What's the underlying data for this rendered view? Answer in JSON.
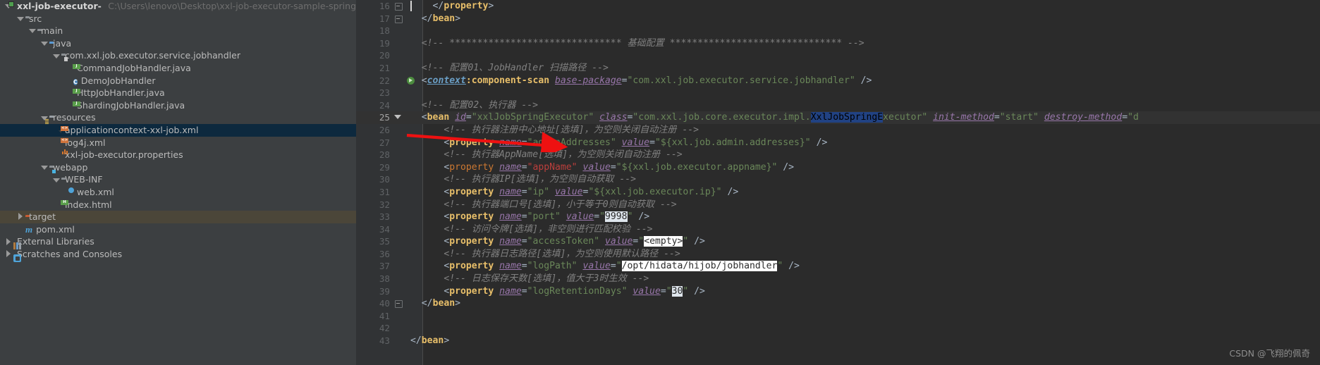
{
  "sidebar": {
    "items": [
      {
        "label": "xxl-job-executor-sample-spring",
        "path": "C:\\Users\\lenovo\\Desktop\\xxl-job-executor-sample-spring",
        "icon": "module-icon",
        "indent": 0,
        "twisty": "open",
        "bold": true,
        "state": "normal"
      },
      {
        "label": "src",
        "path": "",
        "icon": "folder-icon",
        "indent": 1,
        "twisty": "open",
        "bold": false,
        "state": "normal"
      },
      {
        "label": "main",
        "path": "",
        "icon": "folder-icon",
        "indent": 2,
        "twisty": "open",
        "bold": false,
        "state": "normal"
      },
      {
        "label": "java",
        "path": "",
        "icon": "source-folder-icon",
        "indent": 3,
        "twisty": "open",
        "bold": false,
        "state": "normal"
      },
      {
        "label": "com.xxl.job.executor.service.jobhandler",
        "path": "",
        "icon": "package-icon",
        "indent": 4,
        "twisty": "open",
        "bold": false,
        "state": "normal"
      },
      {
        "label": "CommandJobHandler.java",
        "path": "",
        "icon": "java-file-icon",
        "indent": 5,
        "twisty": "none",
        "bold": false,
        "state": "normal"
      },
      {
        "label": "DemoJobHandler",
        "path": "",
        "icon": "java-class-icon",
        "indent": 5,
        "twisty": "none",
        "bold": false,
        "state": "normal"
      },
      {
        "label": "HttpJobHandler.java",
        "path": "",
        "icon": "java-file-icon",
        "indent": 5,
        "twisty": "none",
        "bold": false,
        "state": "normal"
      },
      {
        "label": "ShardingJobHandler.java",
        "path": "",
        "icon": "java-file-icon",
        "indent": 5,
        "twisty": "none",
        "bold": false,
        "state": "normal"
      },
      {
        "label": "resources",
        "path": "",
        "icon": "resources-folder-icon",
        "indent": 3,
        "twisty": "open",
        "bold": false,
        "state": "normal"
      },
      {
        "label": "applicationcontext-xxl-job.xml",
        "path": "",
        "icon": "xml-file-icon",
        "indent": 4,
        "twisty": "none",
        "bold": false,
        "state": "selected"
      },
      {
        "label": "log4j.xml",
        "path": "",
        "icon": "xml-file-icon",
        "indent": 4,
        "twisty": "none",
        "bold": false,
        "state": "normal"
      },
      {
        "label": "xxl-job-executor.properties",
        "path": "",
        "icon": "properties-file-icon",
        "indent": 4,
        "twisty": "none",
        "bold": false,
        "state": "normal"
      },
      {
        "label": "webapp",
        "path": "",
        "icon": "webapp-folder-icon",
        "indent": 3,
        "twisty": "open",
        "bold": false,
        "state": "normal"
      },
      {
        "label": "WEB-INF",
        "path": "",
        "icon": "folder-icon",
        "indent": 4,
        "twisty": "open",
        "bold": false,
        "state": "normal"
      },
      {
        "label": "web.xml",
        "path": "",
        "icon": "web-xml-icon",
        "indent": 5,
        "twisty": "none",
        "bold": false,
        "state": "normal"
      },
      {
        "label": "index.html",
        "path": "",
        "icon": "html-file-icon",
        "indent": 4,
        "twisty": "none",
        "bold": false,
        "state": "normal"
      },
      {
        "label": "target",
        "path": "",
        "icon": "target-folder-icon",
        "indent": 1,
        "twisty": "closed",
        "bold": false,
        "state": "dimmed"
      },
      {
        "label": "pom.xml",
        "path": "",
        "icon": "maven-icon",
        "indent": 1,
        "twisty": "none",
        "bold": false,
        "state": "normal"
      },
      {
        "label": "External Libraries",
        "path": "",
        "icon": "libraries-icon",
        "indent": 0,
        "twisty": "closed",
        "bold": false,
        "state": "normal"
      },
      {
        "label": "Scratches and Consoles",
        "path": "",
        "icon": "scratches-icon",
        "indent": 0,
        "twisty": "closed",
        "bold": false,
        "state": "normal"
      }
    ]
  },
  "editor": {
    "current_line": 25,
    "first_line_number": 16,
    "lines": [
      {
        "n": 16,
        "gutter": "fold-minus",
        "tokens": [
          {
            "t": "caret",
            "v": ""
          },
          {
            "t": "plain",
            "v": "    "
          },
          {
            "t": "brk",
            "v": "</"
          },
          {
            "t": "tag",
            "v": "property"
          },
          {
            "t": "brk",
            "v": ">"
          }
        ]
      },
      {
        "n": 17,
        "gutter": "fold-minus",
        "tokens": [
          {
            "t": "plain",
            "v": "  "
          },
          {
            "t": "brk",
            "v": "</"
          },
          {
            "t": "tag",
            "v": "bean"
          },
          {
            "t": "brk",
            "v": ">"
          }
        ]
      },
      {
        "n": 18,
        "gutter": "",
        "tokens": []
      },
      {
        "n": 19,
        "gutter": "",
        "tokens": [
          {
            "t": "plain",
            "v": "  "
          },
          {
            "t": "cmt",
            "v": "<!-- ******************************* 基础配置 ******************************* -->"
          }
        ]
      },
      {
        "n": 20,
        "gutter": "",
        "tokens": []
      },
      {
        "n": 21,
        "gutter": "",
        "tokens": [
          {
            "t": "plain",
            "v": "  "
          },
          {
            "t": "cmt",
            "v": "<!-- 配置01、JobHandler 扫描路径 -->"
          }
        ]
      },
      {
        "n": 22,
        "gutter": "run",
        "tokens": [
          {
            "t": "plain",
            "v": "  "
          },
          {
            "t": "brk",
            "v": "<"
          },
          {
            "t": "ns",
            "v": "context"
          },
          {
            "t": "nsname",
            "v": ":component-scan"
          },
          {
            "t": "plain",
            "v": " "
          },
          {
            "t": "attr",
            "v": "base-package"
          },
          {
            "t": "brk",
            "v": "="
          },
          {
            "t": "val",
            "v": "\"com.xxl.job.executor.service.jobhandler\""
          },
          {
            "t": "plain",
            "v": " "
          },
          {
            "t": "brk",
            "v": "/>"
          }
        ]
      },
      {
        "n": 23,
        "gutter": "",
        "tokens": []
      },
      {
        "n": 24,
        "gutter": "",
        "tokens": [
          {
            "t": "plain",
            "v": "  "
          },
          {
            "t": "cmt",
            "v": "<!-- 配置02、执行器 -->"
          }
        ]
      },
      {
        "n": 25,
        "gutter": "fold-arrow",
        "tokens": [
          {
            "t": "plain",
            "v": "  "
          },
          {
            "t": "brk",
            "v": "<"
          },
          {
            "t": "tag",
            "v": "bean"
          },
          {
            "t": "plain",
            "v": " "
          },
          {
            "t": "attr",
            "v": "id"
          },
          {
            "t": "brk",
            "v": "="
          },
          {
            "t": "val",
            "v": "\"xxlJobSpringExecutor\""
          },
          {
            "t": "plain",
            "v": " "
          },
          {
            "t": "attr",
            "v": "class"
          },
          {
            "t": "brk",
            "v": "="
          },
          {
            "t": "val",
            "v": "\"com.xxl.job.core.executor.impl."
          },
          {
            "t": "selword",
            "v": "XxlJobSpringE"
          },
          {
            "t": "val",
            "v": "xecutor\""
          },
          {
            "t": "plain",
            "v": " "
          },
          {
            "t": "attr",
            "v": "init-method"
          },
          {
            "t": "brk",
            "v": "="
          },
          {
            "t": "val",
            "v": "\"start\""
          },
          {
            "t": "plain",
            "v": " "
          },
          {
            "t": "attr",
            "v": "destroy-method"
          },
          {
            "t": "brk",
            "v": "="
          },
          {
            "t": "val",
            "v": "\"d"
          }
        ]
      },
      {
        "n": 26,
        "gutter": "",
        "tokens": [
          {
            "t": "plain",
            "v": "      "
          },
          {
            "t": "cmt",
            "v": "<!-- 执行器注册中心地址[选填]，为空则关闭自动注册 -->"
          }
        ]
      },
      {
        "n": 27,
        "gutter": "",
        "tokens": [
          {
            "t": "plain",
            "v": "      "
          },
          {
            "t": "brk",
            "v": "<"
          },
          {
            "t": "tag",
            "v": "property"
          },
          {
            "t": "plain",
            "v": " "
          },
          {
            "t": "attr",
            "v": "name"
          },
          {
            "t": "brk",
            "v": "="
          },
          {
            "t": "val",
            "v": "\"adminAddresses\""
          },
          {
            "t": "plain",
            "v": " "
          },
          {
            "t": "attr",
            "v": "value"
          },
          {
            "t": "brk",
            "v": "="
          },
          {
            "t": "val",
            "v": "\"${xxl.job.admin.addresses}\""
          },
          {
            "t": "plain",
            "v": " "
          },
          {
            "t": "brk",
            "v": "/>"
          }
        ]
      },
      {
        "n": 28,
        "gutter": "",
        "tokens": [
          {
            "t": "plain",
            "v": "      "
          },
          {
            "t": "cmt",
            "v": "<!-- 执行器AppName[选填]，为空则关闭自动注册 -->"
          }
        ]
      },
      {
        "n": 29,
        "gutter": "",
        "tokens": [
          {
            "t": "plain",
            "v": "      "
          },
          {
            "t": "brk",
            "v": "<"
          },
          {
            "t": "tagerr",
            "v": "property"
          },
          {
            "t": "plain",
            "v": " "
          },
          {
            "t": "attr",
            "v": "name"
          },
          {
            "t": "brk",
            "v": "="
          },
          {
            "t": "err",
            "v": "\"appName\""
          },
          {
            "t": "plain",
            "v": " "
          },
          {
            "t": "attr",
            "v": "value"
          },
          {
            "t": "brk",
            "v": "="
          },
          {
            "t": "val",
            "v": "\"${xxl.job.executor.appname}\""
          },
          {
            "t": "plain",
            "v": " "
          },
          {
            "t": "brk",
            "v": "/>"
          }
        ]
      },
      {
        "n": 30,
        "gutter": "",
        "tokens": [
          {
            "t": "plain",
            "v": "      "
          },
          {
            "t": "cmt",
            "v": "<!-- 执行器IP[选填]，为空则自动获取 -->"
          }
        ]
      },
      {
        "n": 31,
        "gutter": "",
        "tokens": [
          {
            "t": "plain",
            "v": "      "
          },
          {
            "t": "brk",
            "v": "<"
          },
          {
            "t": "tag",
            "v": "property"
          },
          {
            "t": "plain",
            "v": " "
          },
          {
            "t": "attr",
            "v": "name"
          },
          {
            "t": "brk",
            "v": "="
          },
          {
            "t": "val",
            "v": "\"ip\""
          },
          {
            "t": "plain",
            "v": " "
          },
          {
            "t": "attr",
            "v": "value"
          },
          {
            "t": "brk",
            "v": "="
          },
          {
            "t": "val",
            "v": "\"${xxl.job.executor.ip}\""
          },
          {
            "t": "plain",
            "v": " "
          },
          {
            "t": "brk",
            "v": "/>"
          }
        ]
      },
      {
        "n": 32,
        "gutter": "",
        "tokens": [
          {
            "t": "plain",
            "v": "      "
          },
          {
            "t": "cmt",
            "v": "<!-- 执行器端口号[选填]，小于等于0则自动获取 -->"
          }
        ]
      },
      {
        "n": 33,
        "gutter": "",
        "tokens": [
          {
            "t": "plain",
            "v": "      "
          },
          {
            "t": "brk",
            "v": "<"
          },
          {
            "t": "tag",
            "v": "property"
          },
          {
            "t": "plain",
            "v": " "
          },
          {
            "t": "attr",
            "v": "name"
          },
          {
            "t": "brk",
            "v": "="
          },
          {
            "t": "val",
            "v": "\"port\""
          },
          {
            "t": "plain",
            "v": " "
          },
          {
            "t": "attr",
            "v": "value"
          },
          {
            "t": "brk",
            "v": "="
          },
          {
            "t": "val",
            "v": "\""
          },
          {
            "t": "hl",
            "v": "9998"
          },
          {
            "t": "val",
            "v": "\""
          },
          {
            "t": "plain",
            "v": " "
          },
          {
            "t": "brk",
            "v": "/>"
          }
        ]
      },
      {
        "n": 34,
        "gutter": "",
        "tokens": [
          {
            "t": "plain",
            "v": "      "
          },
          {
            "t": "cmt",
            "v": "<!-- 访问令牌[选填]，非空则进行匹配校验 -->"
          }
        ]
      },
      {
        "n": 35,
        "gutter": "",
        "tokens": [
          {
            "t": "plain",
            "v": "      "
          },
          {
            "t": "brk",
            "v": "<"
          },
          {
            "t": "tag",
            "v": "property"
          },
          {
            "t": "plain",
            "v": " "
          },
          {
            "t": "attr",
            "v": "name"
          },
          {
            "t": "brk",
            "v": "="
          },
          {
            "t": "val",
            "v": "\"accessToken\""
          },
          {
            "t": "plain",
            "v": " "
          },
          {
            "t": "attr",
            "v": "value"
          },
          {
            "t": "brk",
            "v": "="
          },
          {
            "t": "val",
            "v": "\""
          },
          {
            "t": "hl2",
            "v": "<empty>"
          },
          {
            "t": "val",
            "v": "\""
          },
          {
            "t": "plain",
            "v": " "
          },
          {
            "t": "brk",
            "v": "/>"
          }
        ]
      },
      {
        "n": 36,
        "gutter": "",
        "tokens": [
          {
            "t": "plain",
            "v": "      "
          },
          {
            "t": "cmt",
            "v": "<!-- 执行器日志路径[选填]，为空则使用默认路径 -->"
          }
        ]
      },
      {
        "n": 37,
        "gutter": "",
        "tokens": [
          {
            "t": "plain",
            "v": "      "
          },
          {
            "t": "brk",
            "v": "<"
          },
          {
            "t": "tag",
            "v": "property"
          },
          {
            "t": "plain",
            "v": " "
          },
          {
            "t": "attr",
            "v": "name"
          },
          {
            "t": "brk",
            "v": "="
          },
          {
            "t": "val",
            "v": "\"logPath\""
          },
          {
            "t": "plain",
            "v": " "
          },
          {
            "t": "attr",
            "v": "value"
          },
          {
            "t": "brk",
            "v": "="
          },
          {
            "t": "val",
            "v": "\""
          },
          {
            "t": "hl2",
            "v": "/opt/hidata/hijob/jobhandler"
          },
          {
            "t": "val",
            "v": "\""
          },
          {
            "t": "plain",
            "v": " "
          },
          {
            "t": "brk",
            "v": "/>"
          }
        ]
      },
      {
        "n": 38,
        "gutter": "",
        "tokens": [
          {
            "t": "plain",
            "v": "      "
          },
          {
            "t": "cmt",
            "v": "<!-- 日志保存天数[选填]，值大于3时生效 -->"
          }
        ]
      },
      {
        "n": 39,
        "gutter": "",
        "tokens": [
          {
            "t": "plain",
            "v": "      "
          },
          {
            "t": "brk",
            "v": "<"
          },
          {
            "t": "tag",
            "v": "property"
          },
          {
            "t": "plain",
            "v": " "
          },
          {
            "t": "attr",
            "v": "name"
          },
          {
            "t": "brk",
            "v": "="
          },
          {
            "t": "val",
            "v": "\"logRetentionDays\""
          },
          {
            "t": "plain",
            "v": " "
          },
          {
            "t": "attr",
            "v": "value"
          },
          {
            "t": "brk",
            "v": "="
          },
          {
            "t": "val",
            "v": "\""
          },
          {
            "t": "hl",
            "v": "30"
          },
          {
            "t": "val",
            "v": "\""
          },
          {
            "t": "plain",
            "v": " "
          },
          {
            "t": "brk",
            "v": "/>"
          }
        ]
      },
      {
        "n": 40,
        "gutter": "fold-minus",
        "tokens": [
          {
            "t": "plain",
            "v": "  "
          },
          {
            "t": "brk",
            "v": "</"
          },
          {
            "t": "tag",
            "v": "bean"
          },
          {
            "t": "brk",
            "v": ">"
          }
        ]
      },
      {
        "n": 41,
        "gutter": "",
        "tokens": []
      },
      {
        "n": 42,
        "gutter": "",
        "tokens": []
      },
      {
        "n": 43,
        "gutter": "",
        "tokens": [
          {
            "t": "brk",
            "v": "</"
          },
          {
            "t": "tag",
            "v": "bean"
          },
          {
            "t": "brk",
            "v": ">"
          }
        ]
      }
    ]
  },
  "annotation": {
    "arrow_color": "#ee1111",
    "arrow_target_line": 29
  },
  "watermark": {
    "text": "CSDN @飞翔的佩奇",
    "color": "#8d8d8d"
  }
}
